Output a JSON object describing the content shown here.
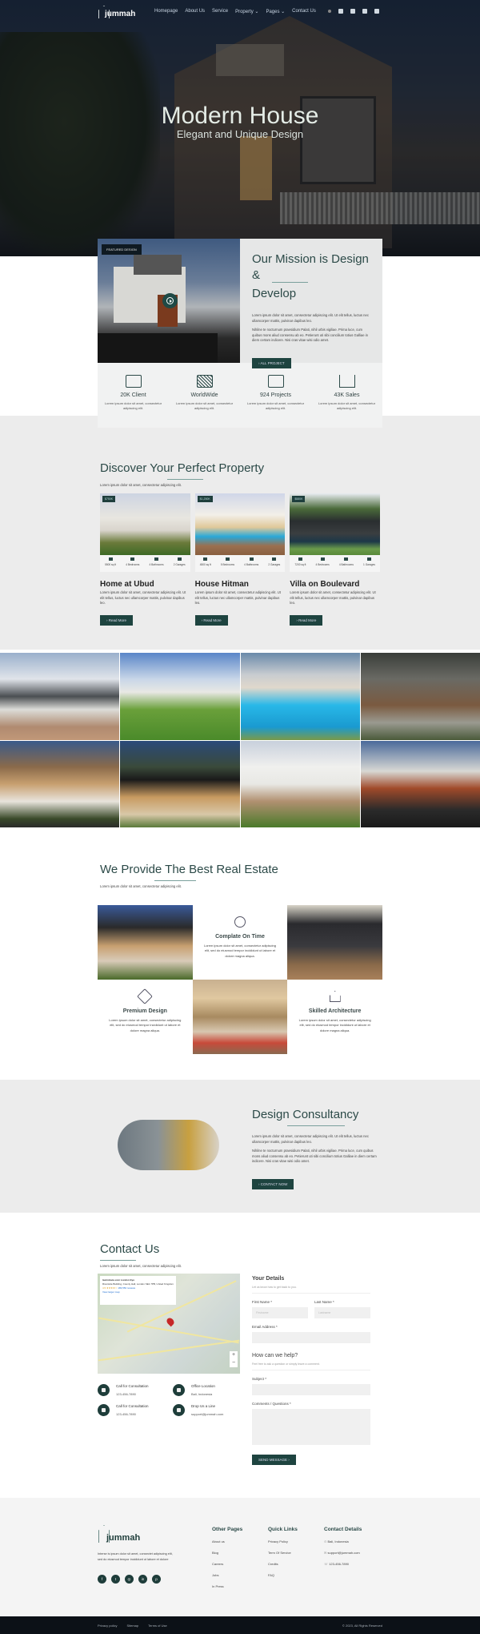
{
  "nav": {
    "logo": "jummah",
    "items": [
      "Homepage",
      "About Us",
      "Service",
      "Property ⌄",
      "Pages ⌄",
      "Contact Us"
    ],
    "social_icons": [
      "search-icon",
      "facebook-icon",
      "instagram-icon",
      "flickr-icon",
      "youtube-icon"
    ]
  },
  "hero": {
    "title": "Modern House",
    "subtitle": "Elegant and Unique Design"
  },
  "mission": {
    "tag": "FEATURED DESIGN",
    "title_line1": "Our Mission is Design &",
    "title_line2": "Develop",
    "p1": "Lorem ipsum dolor sit amet, consectetur adipiscing elit. Ut elit tellus, luctus nec ullamcorper mattis, pulvinar dapibus leo.",
    "p2": "Nihilne te nocturnum praesidium Palati, nihil urbis vigiliae. Prima luce, cum quibus mons aliud consensu ab eo. Petierunt uti sibi concilium totius Galliae in diem certam indicere. Nisi cras vitae wisi odio amet.",
    "button": "› ALL PROJECT"
  },
  "stats": [
    {
      "icon": "monitor-icon",
      "title": "20K Client",
      "desc": "Lorem ipsum dolor sit amet, consectetur adipiscing elit."
    },
    {
      "icon": "map-icon",
      "title": "WorldWide",
      "desc": "Lorem ipsum dolor sit amet, consectetur adipiscing elit."
    },
    {
      "icon": "briefcase-icon",
      "title": "924 Projects",
      "desc": "Lorem ipsum dolor sit amet, consectetur adipiscing elit."
    },
    {
      "icon": "chart-growth-icon",
      "title": "43K Sales",
      "desc": "Lorem ipsum dolor sit amet, consectetur adipiscing elit."
    }
  ],
  "discover": {
    "title": "Discover Your Perfect Property",
    "subtitle": "Lorem ipsum dolor sit amet, consectetur adipiscing elit.",
    "cards": [
      {
        "price": "$750K",
        "name": "Home at Ubud",
        "area": "5500 sq ft",
        "beds": "4 Bedrooms",
        "baths": "4 Bathrooms",
        "garages": "2 Garages",
        "desc": "Lorem ipsum dolor sit amet, consectetur adipiscing elit. Ut elit tellus, luctus nec ullamcorper mattis, pulvinar dapibus leo.",
        "button": "› Read More"
      },
      {
        "price": "$1,250K",
        "name": "House Hitman",
        "area": "4500 sq ft",
        "beds": "5 Bedrooms",
        "baths": "4 Bathrooms",
        "garages": "2 Garages",
        "desc": "Lorem ipsum dolor sit amet, consectetur adipiscing elit. Ut elit tellus, luctus nec ullamcorper mattis, pulvinar dapibus leo.",
        "button": "› Read More"
      },
      {
        "price": "$580K",
        "name": "Villa on Boulevard",
        "area": "7200 sq ft",
        "beds": "4 Bedrooms",
        "baths": "4 Bathrooms",
        "garages": "1 Garages",
        "desc": "Lorem ipsum dolor sit amet, consectetur adipiscing elit. Ut elit tellus, luctus nec ullamcorper mattis, pulvinar dapibus leo.",
        "button": "› Read More"
      }
    ]
  },
  "provide": {
    "title": "We Provide The Best Real Estate",
    "subtitle": "Lorem ipsum dolor sit amet, consectetur adipiscing elit.",
    "features": [
      {
        "icon": "stopwatch-icon",
        "title": "Complate On Time",
        "desc": "Lorem ipsum dolor sit amet, consectetur adipiscing elit, sed do eiusmod tempor incididunt ut labore et dolore magna aliqua."
      },
      {
        "icon": "design-tools-icon",
        "title": "Premium Design",
        "desc": "Lorem ipsum dolor sit amet, consectetur adipiscing elit, sed do eiusmod tempor incididunt ut labore et dolore magna aliqua."
      },
      {
        "icon": "house-icon",
        "title": "Skilled Architecture",
        "desc": "Lorem ipsum dolor sit amet, consectetur adipiscing elit, sed do eiusmod tempor incididunt ut labore et dolore magna aliqua."
      }
    ]
  },
  "consultancy": {
    "title": "Design Consultancy",
    "p1": "Lorem ipsum dolor sit amet, consectetur adipiscing elit. Ut elit tellus, luctus nec ullamcorper mattis, pulvinar dapibus leo.",
    "p2": "Nihilne te nocturnum praesidium Palati, nihil urbis vigiliae. Prima luce, cum quibus mons aliud consensu ab eo. Petierunt uti sibi concilium totius Galliae in diem certam indicere. Nisi cras vitae wisi odio amet.",
    "button": "› CONTACT NOW"
  },
  "contact": {
    "title": "Contact Us",
    "subtitle": "Lorem ipsum dolor sit amet, consectetur adipiscing elit.",
    "map": {
      "place": "lastminute.com London Eye",
      "address": "Riverside Building, County Hall, London SE1 7PB, United Kingdom",
      "rating": "4.5 ★★★★☆",
      "reviews": "183,550 reviews",
      "link": "View larger map",
      "directions": "Directions",
      "zoom_in": "+",
      "zoom_out": "−"
    },
    "info": [
      {
        "icon": "phone-icon",
        "label": "Call for Consultation",
        "value": "123-456-7890"
      },
      {
        "icon": "location-pin-icon",
        "label": "Office Location",
        "value": "Bali, Indonesia"
      },
      {
        "icon": "phone-icon",
        "label": "Call for Consultation",
        "value": "123-456-7890"
      },
      {
        "icon": "envelope-icon",
        "label": "Drop Us a Line",
        "value": "support@jummah.com"
      }
    ],
    "form": {
      "details_title": "Your Details",
      "details_sub": "Let us know how to get back to you.",
      "first_name": "First Name *",
      "first_placeholder": "Firstname",
      "last_name": "Last Name *",
      "last_placeholder": "Lastname",
      "email": "Email Address *",
      "help_title": "How can we help?",
      "help_sub": "Feel free to ask a question or simply leave a comment.",
      "subject": "Subject *",
      "comments": "Comments / Questions *",
      "submit": "SEND MESSAGE ›"
    }
  },
  "footer": {
    "logo": "jummah",
    "desc": "Interse is ipsum dolor sit amet, consectet adipiscing elit, sed do eiusmod tempor incididunt ut labore et dolore",
    "social": [
      "facebook-icon",
      "twitter-icon",
      "instagram-icon",
      "linkedin-icon",
      "pinterest-icon"
    ],
    "social_glyphs": [
      "f",
      "t",
      "◎",
      "in",
      "p"
    ],
    "other_pages": {
      "title": "Other Pages",
      "items": [
        "About us",
        "Blog",
        "Careers",
        "Jobs",
        "In Press"
      ]
    },
    "quick_links": {
      "title": "Quick Links",
      "items": [
        "Privacy Policy",
        "Term Of Service",
        "Credits",
        "FAQ"
      ]
    },
    "contact_details": {
      "title": "Contact Details",
      "items": [
        "Bali, Indonesia",
        "support@jummah.com",
        "123-456-7890"
      ]
    },
    "bottom_links": [
      "Privacy policy",
      "Sitemap",
      "Terms of Use"
    ],
    "copyright": "© 2023, All Rights Reserved"
  }
}
